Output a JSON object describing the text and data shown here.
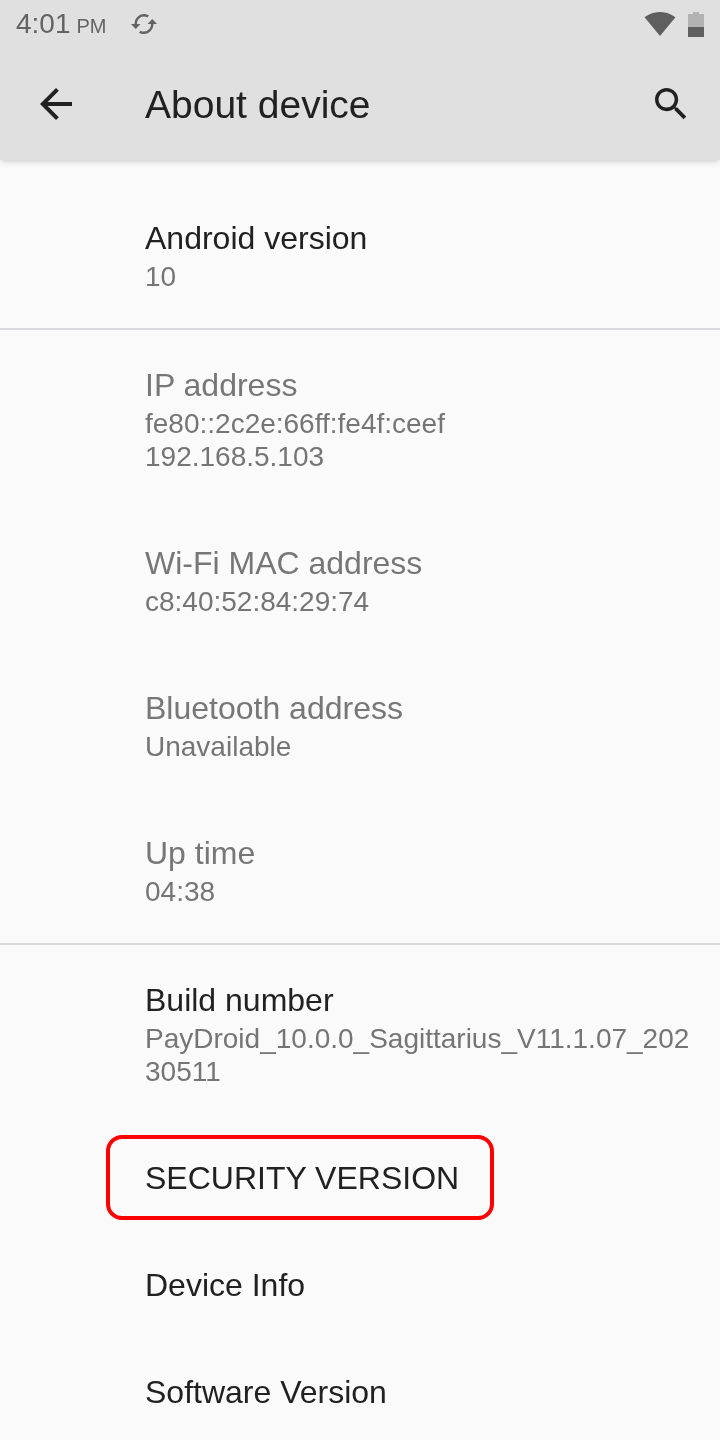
{
  "status_bar": {
    "time": "4:01",
    "period": "PM"
  },
  "toolbar": {
    "title": "About device"
  },
  "sections": [
    {
      "items": [
        {
          "title": "Android version",
          "summary": [
            "10"
          ],
          "disabled": false
        }
      ]
    },
    {
      "items": [
        {
          "title": "IP address",
          "summary": [
            "fe80::2c2e:66ff:fe4f:ceef",
            "192.168.5.103"
          ],
          "disabled": true
        },
        {
          "title": "Wi-Fi MAC address",
          "summary": [
            "c8:40:52:84:29:74"
          ],
          "disabled": true
        },
        {
          "title": "Bluetooth address",
          "summary": [
            "Unavailable"
          ],
          "disabled": true
        },
        {
          "title": "Up time",
          "summary": [
            "04:38"
          ],
          "disabled": true
        }
      ]
    },
    {
      "items": [
        {
          "title": "Build number",
          "summary": [
            "PayDroid_10.0.0_Sagittarius_V11.1.07_202",
            "30511"
          ],
          "disabled": false
        },
        {
          "title": "SECURITY VERSION",
          "disabled": false,
          "highlighted": true
        },
        {
          "title": "Device Info",
          "disabled": false
        },
        {
          "title": "Software Version",
          "disabled": false
        }
      ]
    }
  ]
}
